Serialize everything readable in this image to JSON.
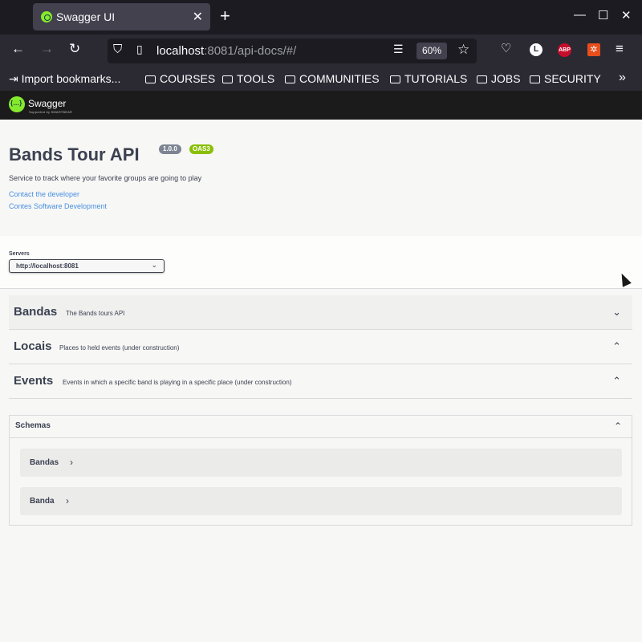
{
  "browser": {
    "tab_title": "Swagger UI",
    "url_host": "localhost",
    "url_path": ":8081/api-docs/#/",
    "zoom": "60%",
    "bookmarks": [
      "Import bookmarks...",
      "COURSES",
      "TOOLS",
      "COMMUNITIES",
      "TUTORIALS",
      "JOBS",
      "SECURITY"
    ]
  },
  "swagger": {
    "brand": "Swagger",
    "brand_sub": "Supported by SMARTBEAR"
  },
  "info": {
    "title": "Bands Tour API",
    "version": "1.0.0",
    "oas": "OAS3",
    "description": "Service to track where your favorite groups are going to play",
    "links": [
      "Contact the developer",
      "Contes Software Development"
    ]
  },
  "servers": {
    "label": "Servers",
    "selected": "http://localhost:8081"
  },
  "tags": [
    {
      "name": "Bandas",
      "description": "The Bands tours API"
    },
    {
      "name": "Locais",
      "description": "Places to held events (under construction)"
    },
    {
      "name": "Events",
      "description": "Events in which a specific band is playing in a specific place (under construction)"
    }
  ],
  "schemas": {
    "title": "Schemas",
    "models": [
      "Bandas",
      "Banda"
    ]
  }
}
